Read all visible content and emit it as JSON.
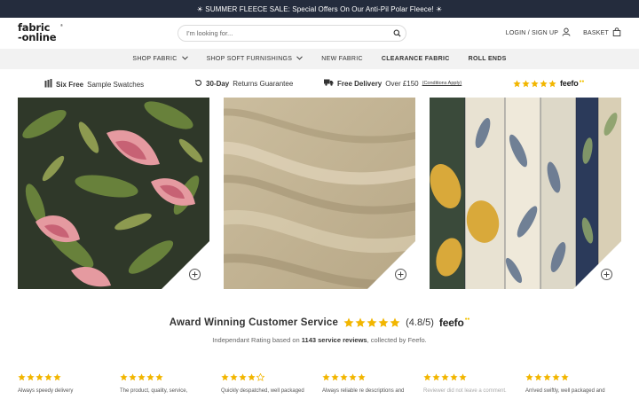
{
  "promo": {
    "text": "☀ SUMMER FLEECE SALE: Special Offers On Our Anti-Pil Polar Fleece! ☀"
  },
  "header": {
    "logo_line1": "fabric",
    "logo_line2": "-online",
    "logo_mark": "®",
    "search_placeholder": "I'm looking for...",
    "login_label": "LOGIN / SIGN UP",
    "basket_label": "BASKET"
  },
  "nav": {
    "items": [
      {
        "label": "SHOP FABRIC"
      },
      {
        "label": "SHOP SOFT FURNISHINGS"
      },
      {
        "label": "NEW FABRIC"
      },
      {
        "label": "CLEARANCE FABRIC"
      },
      {
        "label": "ROLL ENDS"
      }
    ]
  },
  "usp": {
    "swatches_bold": "Six Free",
    "swatches_rest": "Sample Swatches",
    "returns_bold": "30-Day",
    "returns_rest": "Returns Guarantee",
    "delivery_bold": "Free Delivery",
    "delivery_rest": "Over £150",
    "delivery_link": "(Conditions Apply)",
    "feefo_label": "feefo",
    "star_color": "#f2b600"
  },
  "tiles": [
    {
      "name": "floral-pink-fabric",
      "icon": "zoom-plus-icon"
    },
    {
      "name": "beige-plain-fabric",
      "icon": "zoom-plus-icon"
    },
    {
      "name": "morris-leaf-fabric",
      "icon": "zoom-plus-icon"
    }
  ],
  "reviews": {
    "title": "Award Winning Customer Service",
    "rating": "(4.8/5)",
    "feefo_label": "feefo",
    "sub_prefix": "Independant Rating based on",
    "sub_count": "1143 service reviews",
    "sub_suffix": ", collected by Feefo.",
    "cards": [
      {
        "stars": 5,
        "text": "Always speedy delivery"
      },
      {
        "stars": 5,
        "text": "The product, quality, service,"
      },
      {
        "stars": 4,
        "text": "Quickly despatched, well packaged"
      },
      {
        "stars": 5,
        "text": "Always reliable re descriptions and"
      },
      {
        "stars": 5,
        "text": "Reviewer did not leave a comment."
      },
      {
        "stars": 5,
        "text": "Arrived swiftly, well packaged and"
      }
    ]
  }
}
